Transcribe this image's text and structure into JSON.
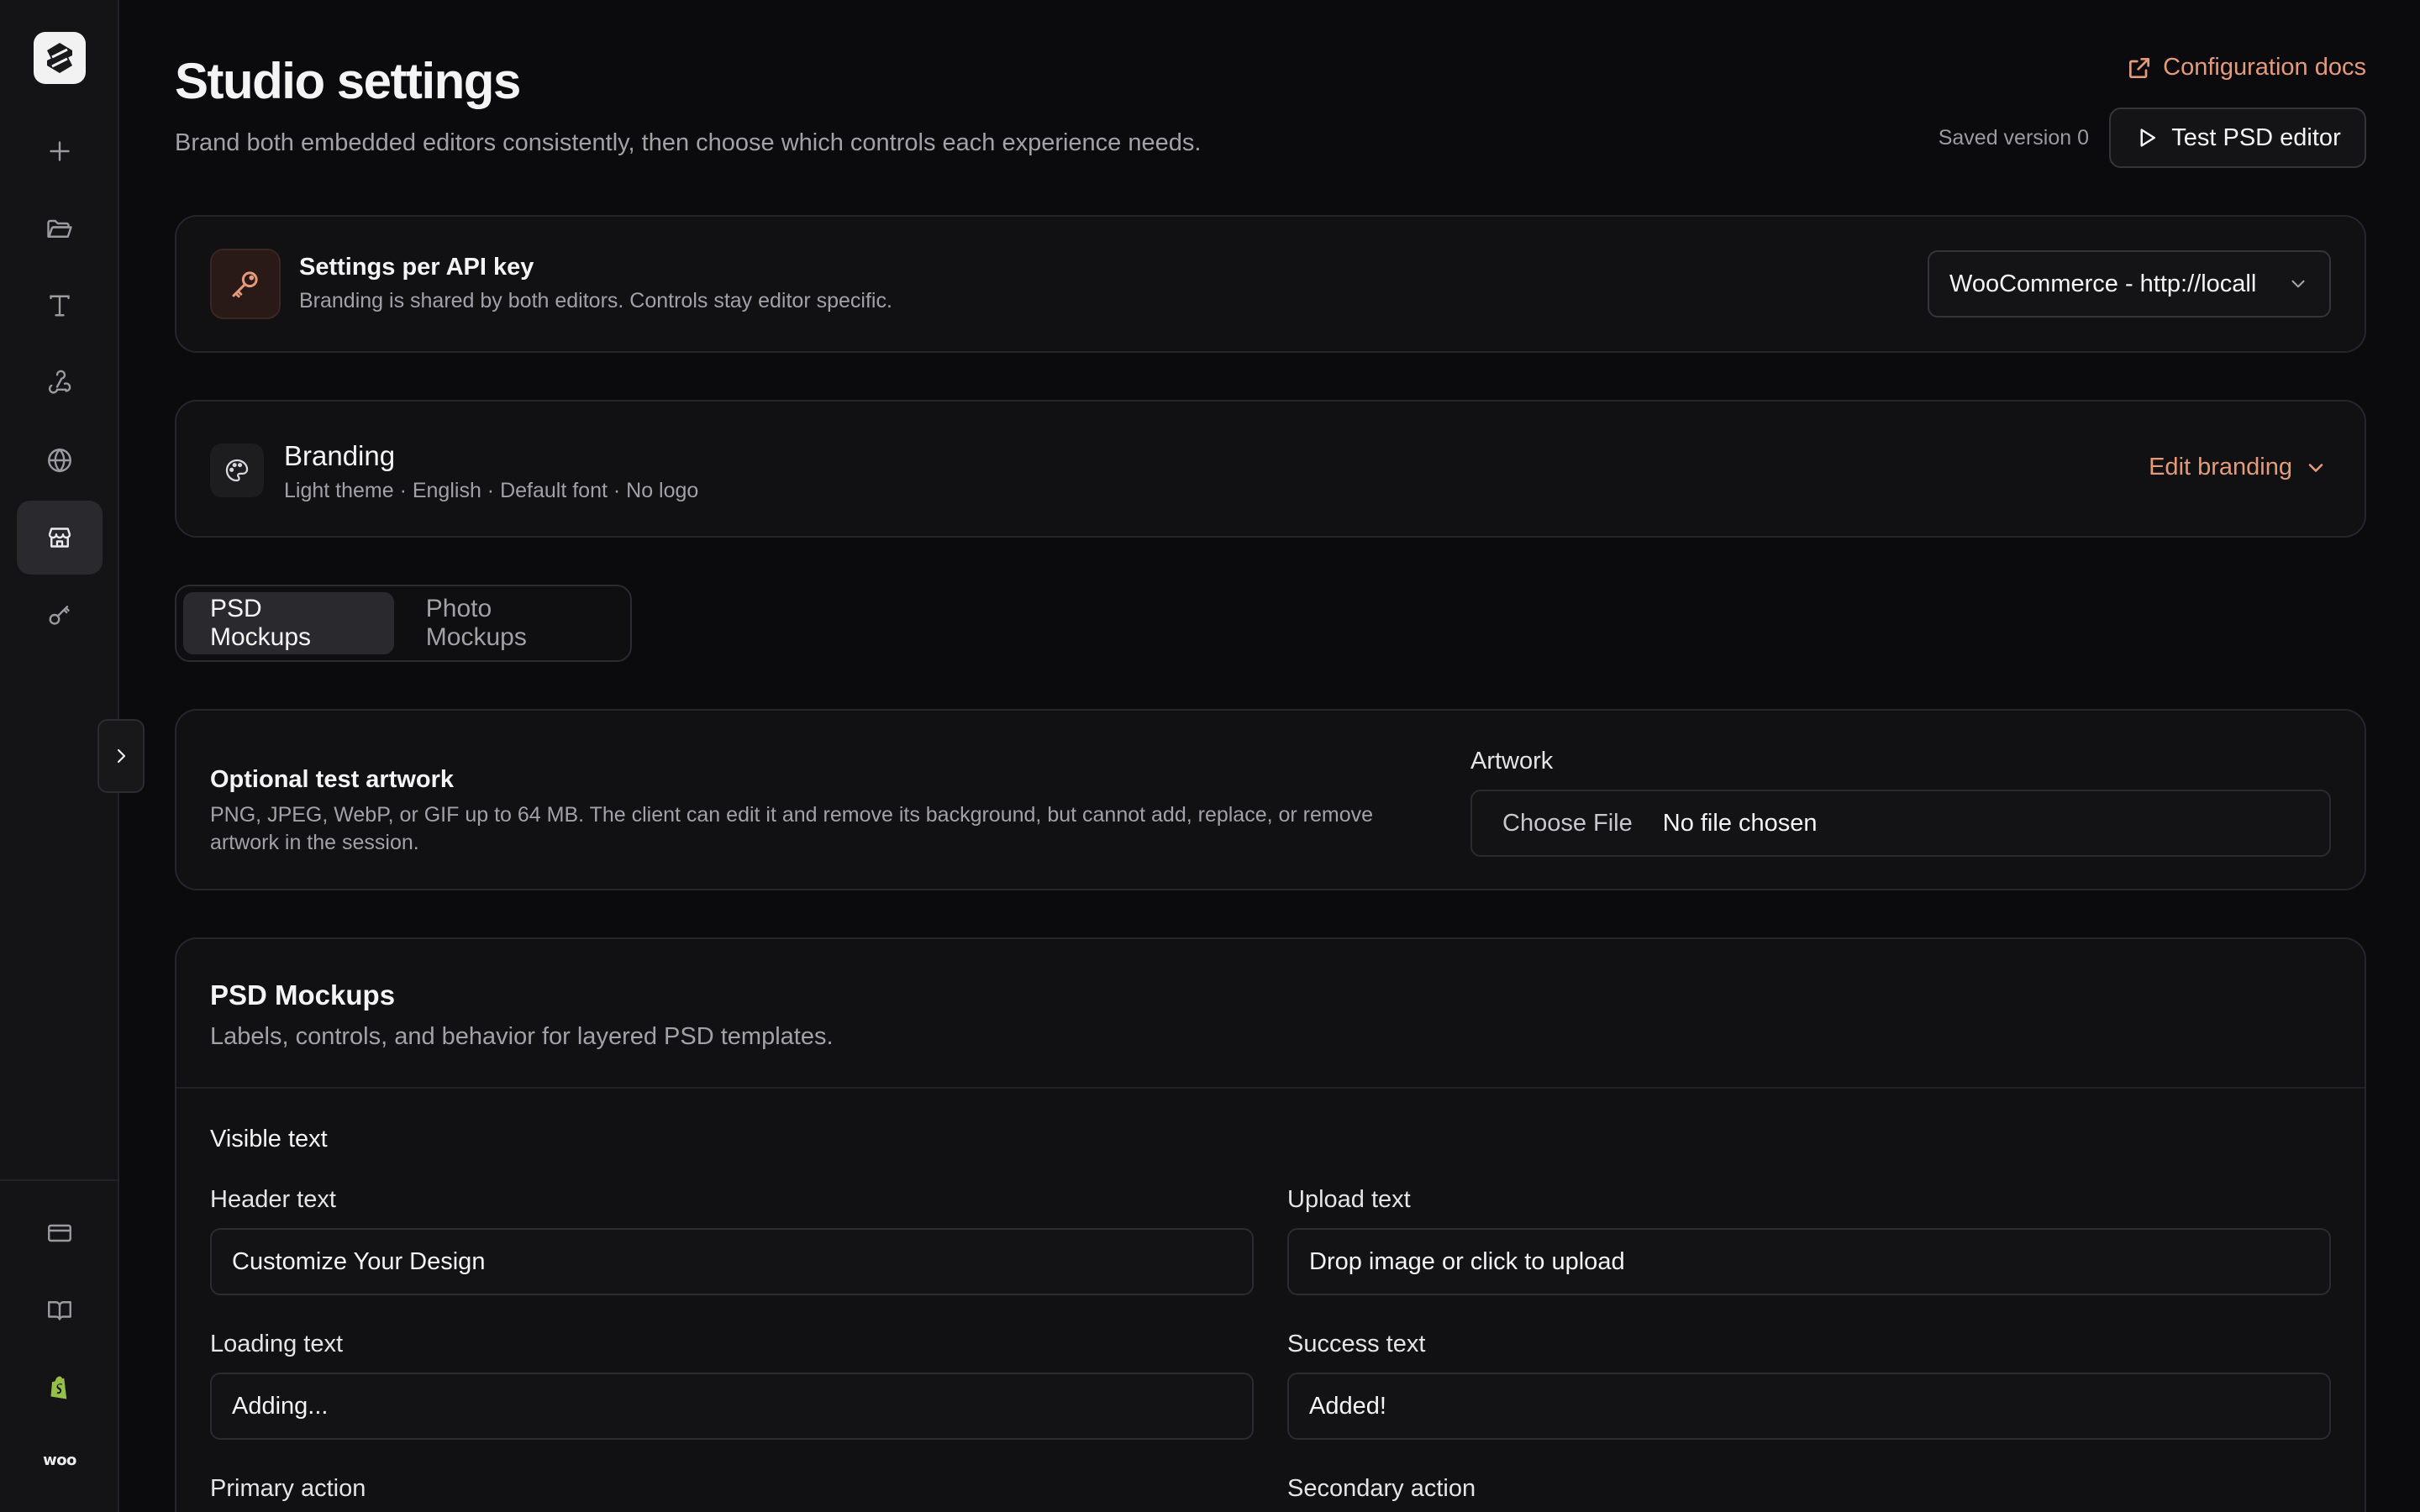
{
  "header": {
    "title": "Studio settings",
    "subtitle": "Brand both embedded editors consistently, then choose which controls each experience needs.",
    "docs_link": "Configuration docs",
    "saved_version": "Saved version 0",
    "test_button": "Test PSD editor"
  },
  "api_key": {
    "title": "Settings per API key",
    "subtitle": "Branding is shared by both editors. Controls stay editor specific.",
    "selected": "WooCommerce - http://locall"
  },
  "branding": {
    "title": "Branding",
    "summary": "Light theme · English · Default font · No logo",
    "edit_label": "Edit branding"
  },
  "tabs": [
    {
      "label": "PSD Mockups",
      "active": true
    },
    {
      "label": "Photo Mockups",
      "active": false
    }
  ],
  "artwork": {
    "title": "Optional test artwork",
    "description": "PNG, JPEG, WebP, or GIF up to 64 MB. The client can edit it and remove its background, but cannot add, replace, or remove artwork in the session.",
    "label": "Artwork",
    "choose_file": "Choose File",
    "file_status": "No file chosen"
  },
  "psd": {
    "title": "PSD Mockups",
    "subtitle": "Labels, controls, and behavior for layered PSD templates.",
    "section_label": "Visible text",
    "fields": {
      "header_text": {
        "label": "Header text",
        "value": "Customize Your Design"
      },
      "upload_text": {
        "label": "Upload text",
        "value": "Drop image or click to upload"
      },
      "loading_text": {
        "label": "Loading text",
        "value": "Adding..."
      },
      "success_text": {
        "label": "Success text",
        "value": "Added!"
      },
      "primary_action": {
        "label": "Primary action"
      },
      "secondary_action": {
        "label": "Secondary action"
      }
    }
  },
  "sidebar": {
    "items": [
      {
        "icon": "plus-icon"
      },
      {
        "icon": "folder-icon"
      },
      {
        "icon": "text-icon"
      },
      {
        "icon": "webhook-icon"
      },
      {
        "icon": "globe-icon"
      },
      {
        "icon": "store-icon",
        "active": true
      },
      {
        "icon": "key-icon"
      }
    ],
    "bottom_items": [
      {
        "icon": "credit-card-icon"
      },
      {
        "icon": "book-icon"
      },
      {
        "icon": "shopify-icon"
      },
      {
        "icon": "woo-icon",
        "text": "woo"
      }
    ]
  },
  "colors": {
    "accent": "#e59a7a",
    "background": "#0b0b0d",
    "card": "#111113",
    "shopify_green": "#95bf47"
  }
}
